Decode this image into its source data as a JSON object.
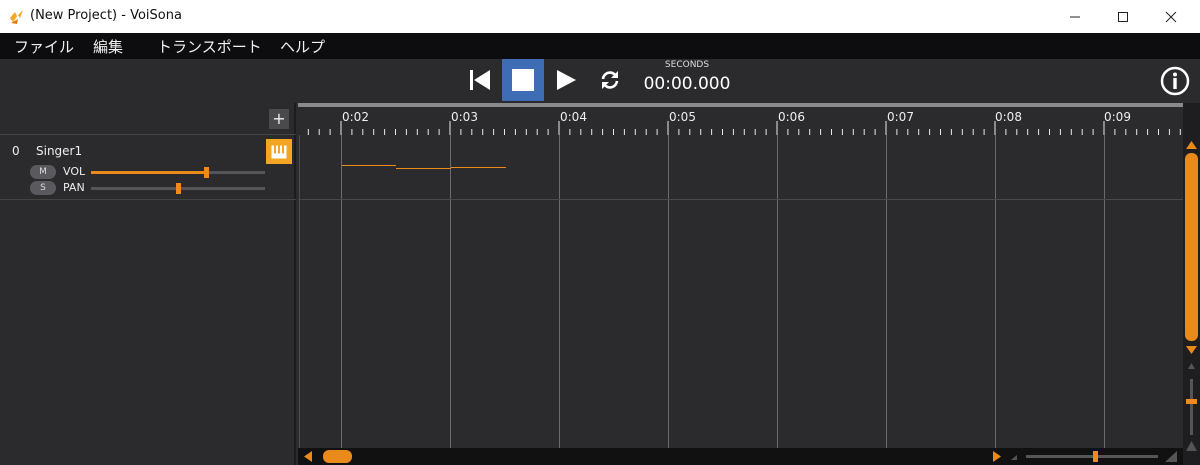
{
  "window": {
    "title": "(New Project) - VoiSona",
    "app_icon": "voisona-logo-icon",
    "controls": [
      "minimize-icon",
      "maximize-icon",
      "close-icon"
    ]
  },
  "menu": {
    "items": [
      "ファイル",
      "編集",
      "トランスポート",
      "ヘルプ"
    ]
  },
  "transport": {
    "buttons": [
      "skip-to-start-icon",
      "stop-icon",
      "play-icon",
      "loop-icon"
    ],
    "active_button": "stop",
    "time_label": "SECONDS",
    "time_value": "00:00.000",
    "info_icon": "info-icon"
  },
  "colors": {
    "accent": "#e98a1a",
    "active_button": "#3e6db5",
    "piano_button": "#f4a623"
  },
  "tracks_panel": {
    "add_icon": "plus-icon",
    "add_label": "+",
    "tracks": [
      {
        "index": "0",
        "name": "Singer1",
        "mute_label": "M",
        "solo_label": "S",
        "vol_label": "VOL",
        "pan_label": "PAN",
        "vol_value": 0.66,
        "pan_value": 0.5
      }
    ]
  },
  "timeline": {
    "ruler_labels": [
      "0:02",
      "0:03",
      "0:04",
      "0:05",
      "0:06",
      "0:07",
      "0:08",
      "0:09"
    ]
  },
  "scrollbars": {
    "vertical_icons": [
      "scroll-up-icon",
      "scroll-down-icon",
      "zoom-in-icon",
      "zoom-out-icon"
    ],
    "horizontal_icons": [
      "scroll-left-icon",
      "scroll-right-icon"
    ]
  }
}
